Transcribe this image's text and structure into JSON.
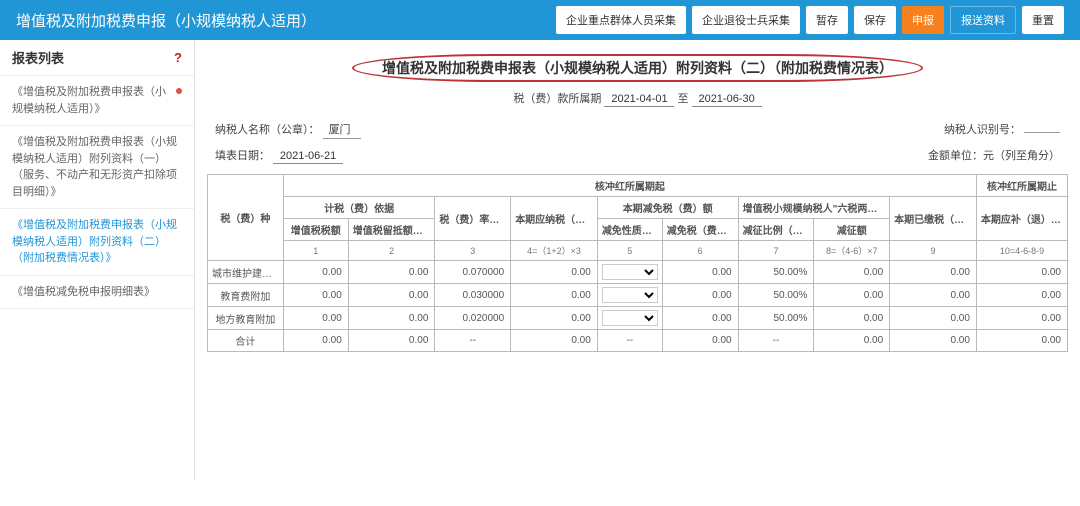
{
  "header": {
    "title": "增值税及附加税费申报（小规模纳税人适用）",
    "buttons": {
      "b1": "企业重点群体人员采集",
      "b2": "企业退役士兵采集",
      "b3": "暂存",
      "b4": "保存",
      "b5": "申报",
      "b6": "报送资料",
      "b7": "重置"
    }
  },
  "sidebar": {
    "title": "报表列表",
    "items": [
      {
        "label": "《增值税及附加税费申报表（小规模纳税人适用）》",
        "active": false,
        "dot": true
      },
      {
        "label": "《增值税及附加税费申报表（小规模纳税人适用）附列资料（一）（服务、不动产和无形资产扣除项目明细）》",
        "active": false,
        "dot": false
      },
      {
        "label": "《增值税及附加税费申报表（小规模纳税人适用）附列资料（二）（附加税费情况表）》",
        "active": true,
        "dot": false
      },
      {
        "label": "《增值税减免税申报明细表》",
        "active": false,
        "dot": false
      }
    ]
  },
  "doc": {
    "title": "增值税及附加税费申报表（小规模纳税人适用）附列资料（二）（附加税费情况表）",
    "period_label": "税（费）款所属期",
    "period_from": "2021-04-01",
    "period_sep": "至",
    "period_to": "2021-06-30",
    "taxpayer_name_label": "纳税人名称（公章）：",
    "taxpayer_name": "厦门",
    "taxpayer_id_label": "纳税人识别号：",
    "fill_date_label": "填表日期：",
    "fill_date": "2021-06-21",
    "unit_label": "金额单位：元（列至角分）"
  },
  "tableHeaders": {
    "row1": {
      "c1": "税（费）种",
      "c2": "核冲红所属期起",
      "c3": "核冲红所属期止"
    },
    "row2": {
      "g1": "计税（费）依据",
      "g2": "税（费）率（征收率）（%）",
      "g3": "本期应纳税（费）额",
      "g4": "本期减免税（费）额",
      "g5": "增值税小规模纳税人\"六税两费\"减征政策",
      "g6": "本期已缴税（费）额",
      "g7": "本期应补（退）税（费）额"
    },
    "row3": {
      "s1": "增值税税额",
      "s2": "增值税留抵额或免征额",
      "s3": "减免性质代码",
      "s4": "减免税（费）额",
      "s5": "减征比例（%）",
      "s6": "减征额"
    },
    "colnums": {
      "n1": "1",
      "n2": "2",
      "n3": "3",
      "n4": "4=（1+2）×3",
      "n5": "5",
      "n6": "6",
      "n7": "7",
      "n8": "8=（4-6）×7",
      "n9": "9",
      "n10": "10=4-6-8-9"
    }
  },
  "rows": [
    {
      "name": "城市维护建设税",
      "c1": "0.00",
      "c2": "0.00",
      "c3": "0.070000",
      "c4": "0.00",
      "c5": "",
      "c6": "0.00",
      "c7": "50.00%",
      "c8": "0.00",
      "c9": "0.00",
      "c10": "0.00"
    },
    {
      "name": "教育费附加",
      "c1": "0.00",
      "c2": "0.00",
      "c3": "0.030000",
      "c4": "0.00",
      "c5": "",
      "c6": "0.00",
      "c7": "50.00%",
      "c8": "0.00",
      "c9": "0.00",
      "c10": "0.00"
    },
    {
      "name": "地方教育附加",
      "c1": "0.00",
      "c2": "0.00",
      "c3": "0.020000",
      "c4": "0.00",
      "c5": "",
      "c6": "0.00",
      "c7": "50.00%",
      "c8": "0.00",
      "c9": "0.00",
      "c10": "0.00"
    }
  ],
  "total": {
    "name": "合计",
    "c1": "0.00",
    "c2": "0.00",
    "c3": "--",
    "c4": "0.00",
    "c5": "--",
    "c6": "0.00",
    "c7": "--",
    "c8": "0.00",
    "c9": "0.00",
    "c10": "0.00"
  }
}
